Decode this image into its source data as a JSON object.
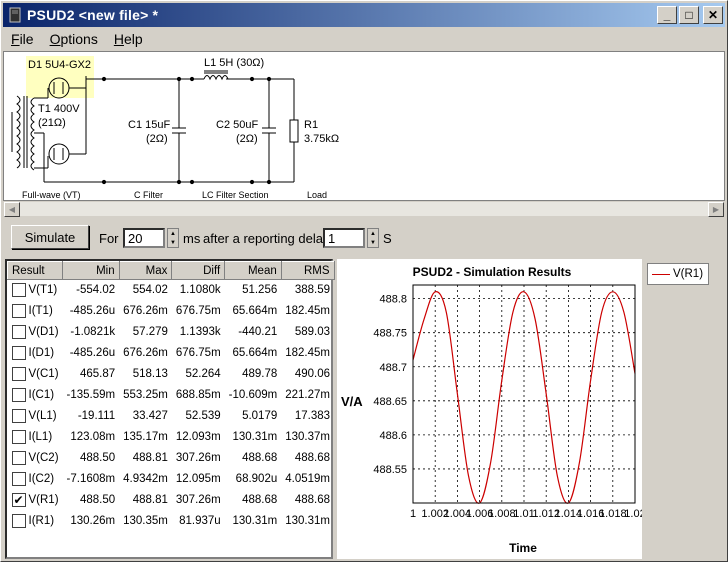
{
  "window": {
    "title": "PSUD2  <new file> *",
    "minimize": "_",
    "maximize": "□",
    "close": "✕"
  },
  "menu": [
    {
      "label": "File",
      "u": "F",
      "rest": "ile"
    },
    {
      "label": "Options",
      "u": "O",
      "rest": "ptions"
    },
    {
      "label": "Help",
      "u": "H",
      "rest": "elp"
    }
  ],
  "schematic": {
    "d1_label": "D1 5U4-GX2",
    "l1_label": "L1 5H (30Ω)",
    "t1_label": "T1 400V",
    "t1_res": "(21Ω)",
    "c1_label": "C1 15uF",
    "c1_res": "(2Ω)",
    "c2_label": "C2 50uF",
    "c2_res": "(2Ω)",
    "r1_label": "R1",
    "r1_value": "3.75kΩ",
    "section_rect": "Full-wave (VT)",
    "section_cfilter": "C Filter",
    "section_lc": "LC Filter Section",
    "section_load": "Load"
  },
  "controls": {
    "simulate_label": "Simulate",
    "for_label": "For",
    "for_value": "20",
    "ms_label": "ms",
    "delay_label": "after a reporting delay of",
    "delay_value": "1",
    "s_label": "S"
  },
  "results": {
    "columns": [
      "Result",
      "Min",
      "Max",
      "Diff",
      "Mean",
      "RMS"
    ],
    "rows": [
      {
        "checked": false,
        "name": "V(T1)",
        "min": "-554.02",
        "max": "554.02",
        "diff": "1.1080k",
        "mean": "51.256",
        "rms": "388.59"
      },
      {
        "checked": false,
        "name": "I(T1)",
        "min": "-485.26u",
        "max": "676.26m",
        "diff": "676.75m",
        "mean": "65.664m",
        "rms": "182.45m"
      },
      {
        "checked": false,
        "name": "V(D1)",
        "min": "-1.0821k",
        "max": "57.279",
        "diff": "1.1393k",
        "mean": "-440.21",
        "rms": "589.03"
      },
      {
        "checked": false,
        "name": "I(D1)",
        "min": "-485.26u",
        "max": "676.26m",
        "diff": "676.75m",
        "mean": "65.664m",
        "rms": "182.45m"
      },
      {
        "checked": false,
        "name": "V(C1)",
        "min": "465.87",
        "max": "518.13",
        "diff": "52.264",
        "mean": "489.78",
        "rms": "490.06"
      },
      {
        "checked": false,
        "name": "I(C1)",
        "min": "-135.59m",
        "max": "553.25m",
        "diff": "688.85m",
        "mean": "-10.609m",
        "rms": "221.27m"
      },
      {
        "checked": false,
        "name": "V(L1)",
        "min": "-19.111",
        "max": "33.427",
        "diff": "52.539",
        "mean": "5.0179",
        "rms": "17.383"
      },
      {
        "checked": false,
        "name": "I(L1)",
        "min": "123.08m",
        "max": "135.17m",
        "diff": "12.093m",
        "mean": "130.31m",
        "rms": "130.37m"
      },
      {
        "checked": false,
        "name": "V(C2)",
        "min": "488.50",
        "max": "488.81",
        "diff": "307.26m",
        "mean": "488.68",
        "rms": "488.68"
      },
      {
        "checked": false,
        "name": "I(C2)",
        "min": "-7.1608m",
        "max": "4.9342m",
        "diff": "12.095m",
        "mean": "68.902u",
        "rms": "4.0519m"
      },
      {
        "checked": true,
        "name": "V(R1)",
        "min": "488.50",
        "max": "488.81",
        "diff": "307.26m",
        "mean": "488.68",
        "rms": "488.68"
      },
      {
        "checked": false,
        "name": "I(R1)",
        "min": "130.26m",
        "max": "130.35m",
        "diff": "81.937u",
        "mean": "130.31m",
        "rms": "130.31m"
      }
    ]
  },
  "legend": {
    "label": "V(R1)",
    "color": "#cc0000"
  },
  "chart_data": {
    "type": "line",
    "title": "PSUD2 - Simulation Results",
    "xlabel": "Time",
    "ylabel": "V/A",
    "xlim": [
      1.0,
      1.02
    ],
    "ylim": [
      488.5,
      488.82
    ],
    "x_ticks": [
      "1",
      "1.002",
      "1.004",
      "1.006",
      "1.008",
      "1.01",
      "1.012",
      "1.014",
      "1.016",
      "1.018",
      "1.02"
    ],
    "y_ticks": [
      "488.55",
      "488.6",
      "488.65",
      "488.7",
      "488.75",
      "488.8"
    ],
    "grid": true,
    "series": [
      {
        "name": "V(R1)",
        "color": "#cc0000",
        "x": [
          1.0,
          1.001,
          1.002,
          1.003,
          1.004,
          1.005,
          1.006,
          1.007,
          1.008,
          1.009,
          1.01,
          1.011,
          1.012,
          1.013,
          1.014,
          1.015,
          1.016,
          1.017,
          1.018,
          1.019,
          1.02
        ],
        "values": [
          488.71,
          488.77,
          488.81,
          488.78,
          488.66,
          488.54,
          488.5,
          488.56,
          488.68,
          488.78,
          488.81,
          488.77,
          488.66,
          488.54,
          488.5,
          488.56,
          488.68,
          488.78,
          488.81,
          488.78,
          488.69
        ]
      }
    ]
  }
}
